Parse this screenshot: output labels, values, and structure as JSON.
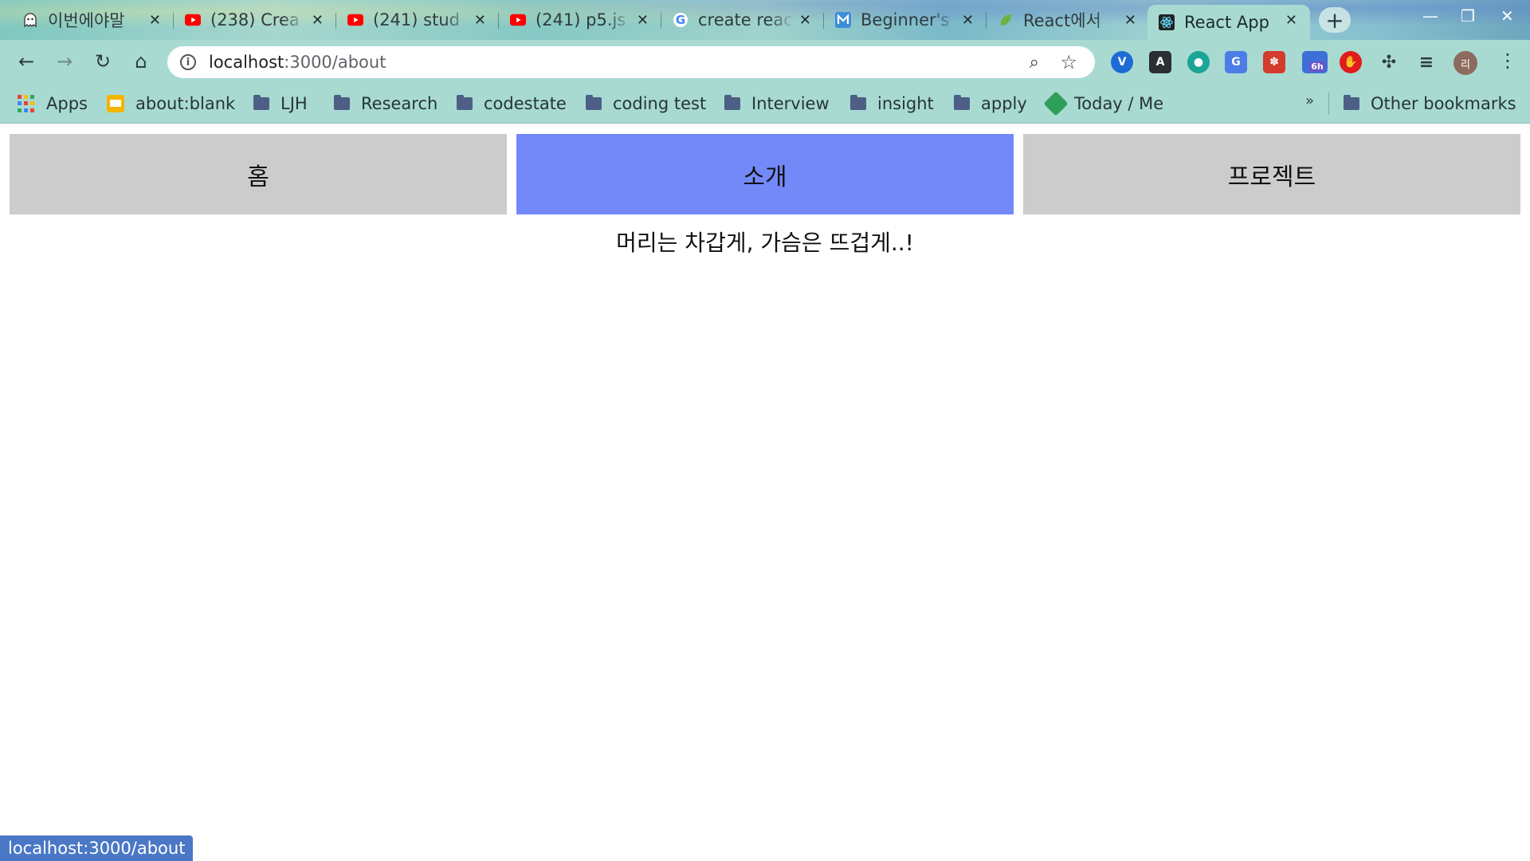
{
  "tabs": [
    {
      "title": "이번에야말",
      "favicon": "ghost-icon"
    },
    {
      "title": "(238) Crea",
      "favicon": "youtube-icon"
    },
    {
      "title": "(241) stud",
      "favicon": "youtube-icon"
    },
    {
      "title": "(241) p5.js",
      "favicon": "youtube-icon"
    },
    {
      "title": "create reac",
      "favicon": "google-icon"
    },
    {
      "title": "Beginner's",
      "favicon": "m-icon"
    },
    {
      "title": "React에서",
      "favicon": "leaf-icon"
    },
    {
      "title": "React App",
      "favicon": "react-icon"
    }
  ],
  "address": {
    "host": "localhost",
    "path": ":3000/about"
  },
  "bookmarks": [
    {
      "label": "Apps",
      "icon": "apps-grid-icon"
    },
    {
      "label": "about:blank",
      "icon": "page-icon"
    },
    {
      "label": "LJH",
      "icon": "folder-icon"
    },
    {
      "label": "Research",
      "icon": "folder-icon"
    },
    {
      "label": "codestate",
      "icon": "folder-icon"
    },
    {
      "label": "coding test",
      "icon": "folder-icon"
    },
    {
      "label": "Interview",
      "icon": "folder-icon"
    },
    {
      "label": "insight",
      "icon": "folder-icon"
    },
    {
      "label": "apply",
      "icon": "folder-icon"
    },
    {
      "label": "Today / Me",
      "icon": "diamond-icon"
    }
  ],
  "other_bookmarks": "Other bookmarks",
  "extensions": {
    "badge": "6h"
  },
  "avatar_initial": "리",
  "page": {
    "nav": [
      "홈",
      "소개",
      "프로젝트"
    ],
    "active_index": 1,
    "motto": "머리는 차갑게, 가슴은 뜨겁게..!"
  },
  "status_url": "localhost:3000/about",
  "colors": {
    "active_nav": "#7489f8",
    "nav": "#cccccc",
    "chrome": "#a8dad2",
    "status": "#4a78c6"
  }
}
